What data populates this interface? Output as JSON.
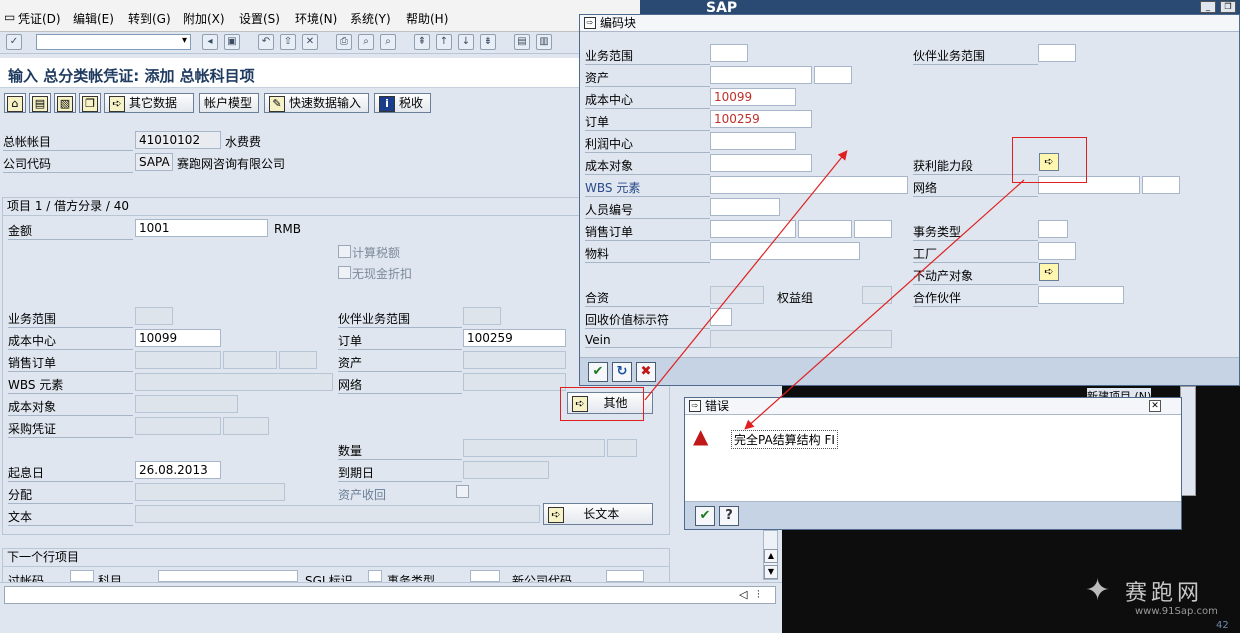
{
  "menu": [
    "凭证(D)",
    "编辑(E)",
    "转到(G)",
    "附加(X)",
    "设置(S)",
    "环境(N)",
    "系统(Y)",
    "帮助(H)"
  ],
  "title": "输入 总分类帐凭证: 添加 总帐科目项",
  "app_toolbar": {
    "other_data": "其它数据",
    "account_model": "帐户模型",
    "fast_entry": "快速数据输入",
    "tax": "税收"
  },
  "header": {
    "gl_account_label": "总帐帐目",
    "gl_account_value": "41010102",
    "gl_account_text": "水费费",
    "company_label": "公司代码",
    "company_value": "SAPA",
    "company_text": "赛跑网咨询有限公司"
  },
  "item_group": {
    "title": "项目 1 / 借方分录 / 40",
    "amount_label": "金额",
    "amount_value": "1001",
    "currency": "RMB",
    "calc_tax": "计算税额",
    "no_cash_discount": "无现金折扣",
    "business_area": "业务范围",
    "partner_business_area": "伙伴业务范围",
    "cost_center_label": "成本中心",
    "cost_center_value": "10099",
    "order_label": "订单",
    "order_value": "100259",
    "sales_order": "销售订单",
    "asset": "资产",
    "wbs": "WBS 元素",
    "network": "网络",
    "cost_object": "成本对象",
    "purchase_doc": "采购凭证",
    "more_button": "其他",
    "quantity": "数量",
    "value_date_label": "起息日",
    "value_date_value": "26.08.2013",
    "due_date": "到期日",
    "assignment": "分配",
    "asset_retirement": "资产收回",
    "text": "文本",
    "long_text_button": "长文本"
  },
  "next_item": {
    "title": "下一个行项目",
    "columns": [
      "过帐码",
      "科目",
      "SGL标识",
      "事务类型",
      "新公司代码"
    ]
  },
  "code_block": {
    "title": "编码块",
    "sap_logo": "SAP",
    "business_area": "业务范围",
    "partner_business_area": "伙伴业务范围",
    "asset": "资产",
    "cost_center_label": "成本中心",
    "cost_center_value": "10099",
    "order_label": "订单",
    "order_value": "100259",
    "profit_center": "利润中心",
    "cost_object": "成本对象",
    "profitability_segment": "获利能力段",
    "wbs": "WBS 元素",
    "network": "网络",
    "personnel_no": "人员编号",
    "sales_order": "销售订单",
    "transaction_type": "事务类型",
    "material": "物料",
    "plant": "工厂",
    "real_estate": "不动产对象",
    "contract": "合资",
    "equity_group": "权益组",
    "partner": "合作伙伴",
    "recovery_indicator": "回收价值标示符",
    "vein": "Vein"
  },
  "error_dialog": {
    "title": "错误",
    "message": "完全PA结算结构 FI"
  },
  "background": {
    "new_item": "新建项目 (N)",
    "watermark_text": "赛跑网",
    "watermark_url": "www.91Sap.com",
    "corner_number": "42"
  }
}
